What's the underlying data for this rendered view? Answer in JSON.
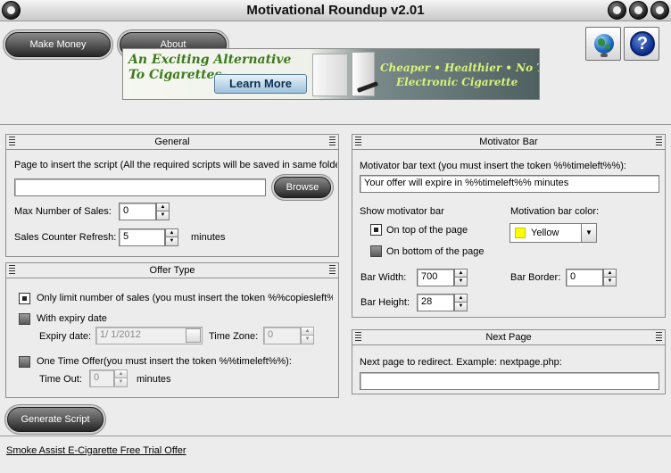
{
  "window": {
    "title": "Motivational Roundup v2.01"
  },
  "toolbar": {
    "make_money_label": "Make Money",
    "about_label": "About",
    "globe_icon": "globe-icon",
    "help_icon": "help-icon",
    "help_glyph": "?"
  },
  "banner": {
    "line1": "An Exciting Alternative",
    "line2": "To Cigarettes",
    "cta": "Learn More",
    "right_line1": "Cheaper • Healthier • No Tar",
    "right_line2": "Electronic Cigarette"
  },
  "general": {
    "title": "General",
    "page_label": "Page to insert the script (All the required scripts will be saved in same folde",
    "page_value": "",
    "browse_label": "Browse",
    "max_sales_label": "Max Number of Sales:",
    "max_sales_value": "0",
    "refresh_label": "Sales Counter Refresh:",
    "refresh_value": "5",
    "refresh_unit": "minutes"
  },
  "offer": {
    "title": "Offer Type",
    "opt_limit": "Only limit number of sales (you must insert the token %%copiesleft%",
    "opt_expiry": "With expiry date",
    "expiry_label": "Expiry date:",
    "expiry_value": "1/ 1/2012",
    "timezone_label": "Time Zone:",
    "timezone_value": "0",
    "opt_onetime": "One Time Offer(you must insert the token %%timeleft%%):",
    "timeout_label": "Time Out:",
    "timeout_value": "0",
    "timeout_unit": "minutes"
  },
  "motivator": {
    "title": "Motivator Bar",
    "text_label": "Motivator bar text (you must insert the token %%timeleft%%):",
    "text_value": "Your offer will expire in %%timeleft%% minutes",
    "show_label": "Show motivator bar",
    "opt_top": "On top of the page",
    "opt_bottom": "On bottom of the page",
    "color_label": "Motivation bar color:",
    "color_value": "Yellow",
    "color_hex": "#ffff00",
    "width_label": "Bar Width:",
    "width_value": "700",
    "height_label": "Bar Height:",
    "height_value": "28",
    "border_label": "Bar Border:",
    "border_value": "0"
  },
  "next_page": {
    "title": "Next Page",
    "label": "Next page to redirect. Example: nextpage.php:",
    "value": ""
  },
  "actions": {
    "generate_label": "Generate Script"
  },
  "footer": {
    "link": "Smoke Assist E-Cigarette Free Trial Offer"
  }
}
